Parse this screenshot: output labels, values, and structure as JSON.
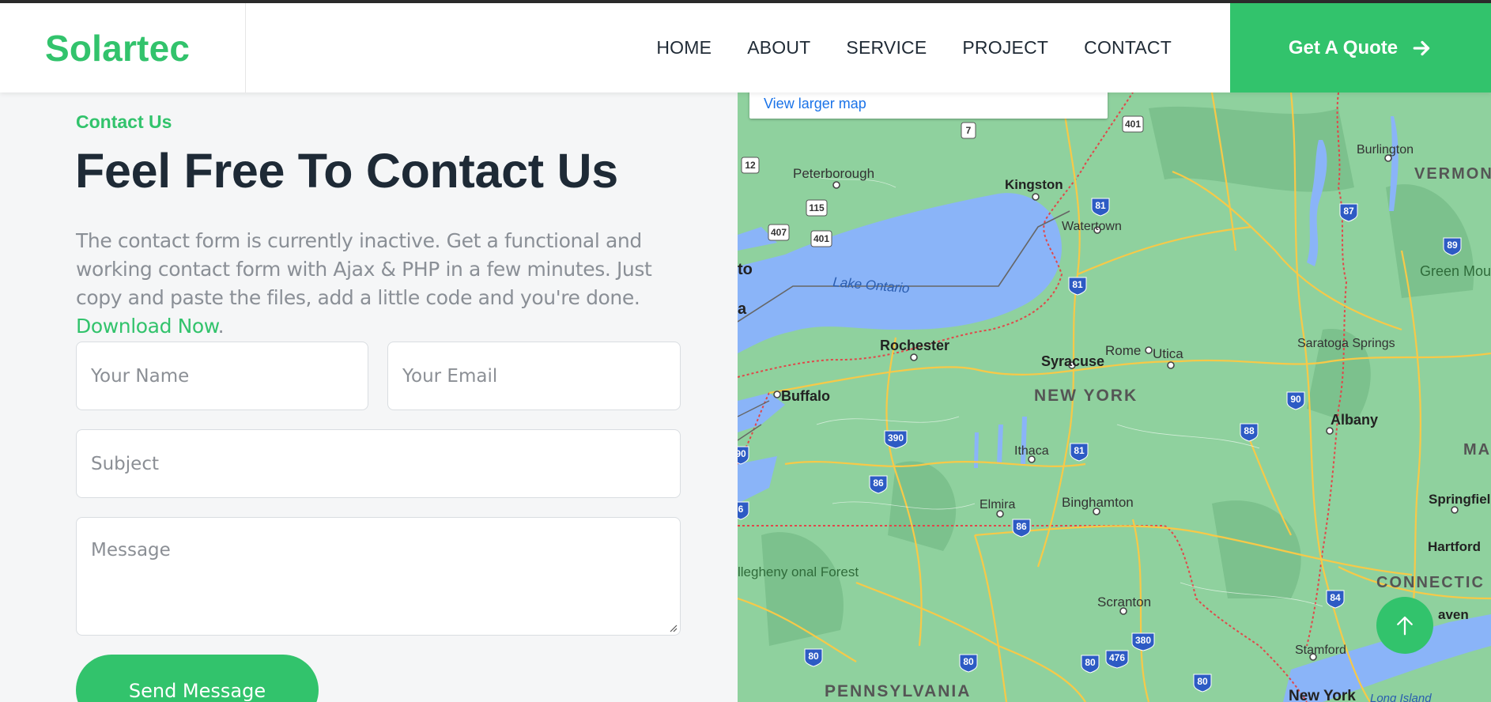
{
  "brand": {
    "name": "Solartec"
  },
  "nav": {
    "items": [
      "HOME",
      "ABOUT",
      "SERVICE",
      "PROJECT",
      "CONTACT"
    ],
    "quote_label": "Get A Quote"
  },
  "contact": {
    "eyebrow": "Contact Us",
    "title": "Feel Free To Contact Us",
    "description": "The contact form is currently inactive. Get a functional and working contact form with Ajax & PHP in a few minutes. Just copy and paste the files, add a little code and you're done.",
    "download_link": "Download Now",
    "form": {
      "name_placeholder": "Your Name",
      "email_placeholder": "Your Email",
      "subject_placeholder": "Subject",
      "message_placeholder": "Message",
      "submit_label": "Send Message"
    }
  },
  "map": {
    "view_larger": "View larger map",
    "places": {
      "peterborough": "Peterborough",
      "kingston": "Kingston",
      "watertown": "Watertown",
      "burlington": "Burlington",
      "vermont": "VERMONT",
      "lake_ontario": "Lake Ontario",
      "to": "to",
      "a": "a",
      "green_mountain": "Green Mountain National Forest",
      "rochester": "Rochester",
      "rome": "Rome",
      "utica": "Utica",
      "syracuse": "Syracuse",
      "saratoga": "Saratoga Springs",
      "buffalo": "Buffalo",
      "new_york_state": "NEW YORK",
      "albany": "Albany",
      "mas": "MAS",
      "ithaca": "Ithaca",
      "elmira": "Elmira",
      "binghamton": "Binghamton",
      "springfield": "Springfiel",
      "hartford": "Hartford",
      "allegheny": "llegheny onal Forest",
      "connecticut": "CONNECTIC",
      "scranton": "Scranton",
      "haven": "aven",
      "stamford": "Stamford",
      "pennsylvania": "PENNSYLVANIA",
      "new_york_city": "New York",
      "long_island": "Long Island"
    },
    "shields": [
      "7",
      "401",
      "12",
      "115",
      "407",
      "401",
      "81",
      "87",
      "89",
      "81",
      "90",
      "390",
      "81",
      "88",
      "86",
      "86",
      "90",
      "84",
      "380",
      "80",
      "80",
      "80",
      "476",
      "80",
      "6",
      "90"
    ]
  },
  "scroll_top": {
    "icon": "arrow-up-icon"
  },
  "colors": {
    "accent": "#32c36c",
    "heading": "#1e2a36",
    "text": "#8a8f96",
    "map_link": "#1a73e8"
  }
}
